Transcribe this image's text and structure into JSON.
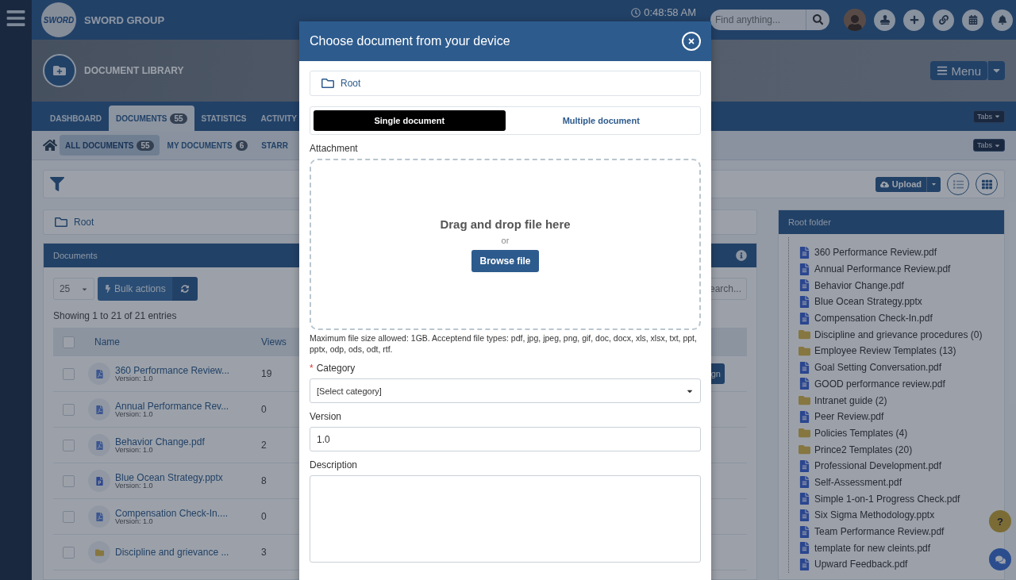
{
  "header": {
    "logo_text": "SWORD",
    "brand": "SWORD GROUP",
    "clock": "0:48:58 AM",
    "search": {
      "placeholder": "Find anything..."
    }
  },
  "banner": {
    "title": "DOCUMENT LIBRARY",
    "menu_button": "Menu"
  },
  "tabs": [
    {
      "label": "DASHBOARD",
      "selected": false
    },
    {
      "label": "DOCUMENTS",
      "count": "55",
      "selected": true
    },
    {
      "label": "STATISTICS",
      "selected": false
    },
    {
      "label": "ACTIVITY",
      "selected": false
    }
  ],
  "tabs_button": "Tabs",
  "subtabs": [
    {
      "label": "ALL DOCUMENTS",
      "count": "55",
      "selected": true
    },
    {
      "label": "MY DOCUMENTS",
      "count": "6",
      "selected": false
    },
    {
      "label": "STARR",
      "selected": false
    }
  ],
  "subtabs_button": "Tabs",
  "toolbar": {
    "upload": "Upload"
  },
  "breadcrumb": "Root",
  "documents": {
    "title": "Documents",
    "page_size": "25",
    "bulk_actions": "Bulk actions",
    "search_placeholder": "earch...",
    "summary": "Showing 1 to 21 of 21 entries",
    "select_all_checked": false,
    "columns": [
      "Name",
      "Views"
    ],
    "action_button": "gn",
    "rows": [
      {
        "kind": "pdf",
        "checked": false,
        "name": "360 Performance Review...",
        "version": "Version: 1.0",
        "views": "19"
      },
      {
        "kind": "pdf",
        "checked": false,
        "name": "Annual Performance Rev...",
        "version": "Version: 1.0",
        "views": "0"
      },
      {
        "kind": "pdf",
        "checked": false,
        "name": "Behavior Change.pdf",
        "version": "Version: 1.0",
        "views": "2"
      },
      {
        "kind": "pptx",
        "checked": false,
        "name": "Blue Ocean Strategy.pptx",
        "version": "Version: 1.0",
        "views": "8"
      },
      {
        "kind": "pdf",
        "checked": false,
        "name": "Compensation Check-In....",
        "version": "Version: 1.0",
        "views": "0"
      },
      {
        "kind": "folder",
        "checked": false,
        "name": "Discipline and grievance ...",
        "views": "3"
      }
    ]
  },
  "folder_panel": {
    "title": "Root folder",
    "items": [
      {
        "kind": "file",
        "name": "360 Performance Review.pdf"
      },
      {
        "kind": "file",
        "name": "Annual Performance Review.pdf"
      },
      {
        "kind": "file",
        "name": "Behavior Change.pdf"
      },
      {
        "kind": "file",
        "name": "Blue Ocean Strategy.pptx"
      },
      {
        "kind": "file",
        "name": "Compensation Check-In.pdf"
      },
      {
        "kind": "folder",
        "name": "Discipline and grievance procedures (0)"
      },
      {
        "kind": "folder",
        "name": "Employee Review Templates (13)"
      },
      {
        "kind": "file",
        "name": "Goal Setting Conversation.pdf"
      },
      {
        "kind": "file",
        "name": "GOOD performance review.pdf"
      },
      {
        "kind": "folder",
        "name": "Intranet guide (2)"
      },
      {
        "kind": "file",
        "name": "Peer Review.pdf"
      },
      {
        "kind": "folder",
        "name": "Policies Templates (4)"
      },
      {
        "kind": "folder",
        "name": "Prince2 Templates (20)"
      },
      {
        "kind": "file",
        "name": "Professional Development.pdf"
      },
      {
        "kind": "file",
        "name": "Self-Assessment.pdf"
      },
      {
        "kind": "file",
        "name": "Simple 1-on-1 Progress Check.pdf"
      },
      {
        "kind": "file",
        "name": "Six Sigma Methodology.pptx"
      },
      {
        "kind": "file",
        "name": "Team Performance Review.pdf"
      },
      {
        "kind": "file",
        "name": "template for new cleints.pdf"
      },
      {
        "kind": "file",
        "name": "Upward Feedback.pdf"
      }
    ]
  },
  "help_button": "?",
  "modal": {
    "title": "Choose document from your device",
    "breadcrumb": "Root",
    "modes": [
      {
        "label": "Single document",
        "selected": true
      },
      {
        "label": "Multiple document",
        "selected": false
      }
    ],
    "attachment_label": "Attachment",
    "drop_text": "Drag and drop file here",
    "or_text": "or",
    "browse_button": "Browse file",
    "help_text": "Maximum file size allowed: 1GB. Acceptend file types: pdf, jpg, jpeg, png, gif, doc, docx, xls, xlsx, txt, ppt, pptx, odp, ods, odt, rtf.",
    "category": {
      "required_mark": "*",
      "label": "Category",
      "value": "[Select category]"
    },
    "version": {
      "label": "Version",
      "value": "1.0"
    },
    "description": {
      "label": "Description"
    }
  }
}
